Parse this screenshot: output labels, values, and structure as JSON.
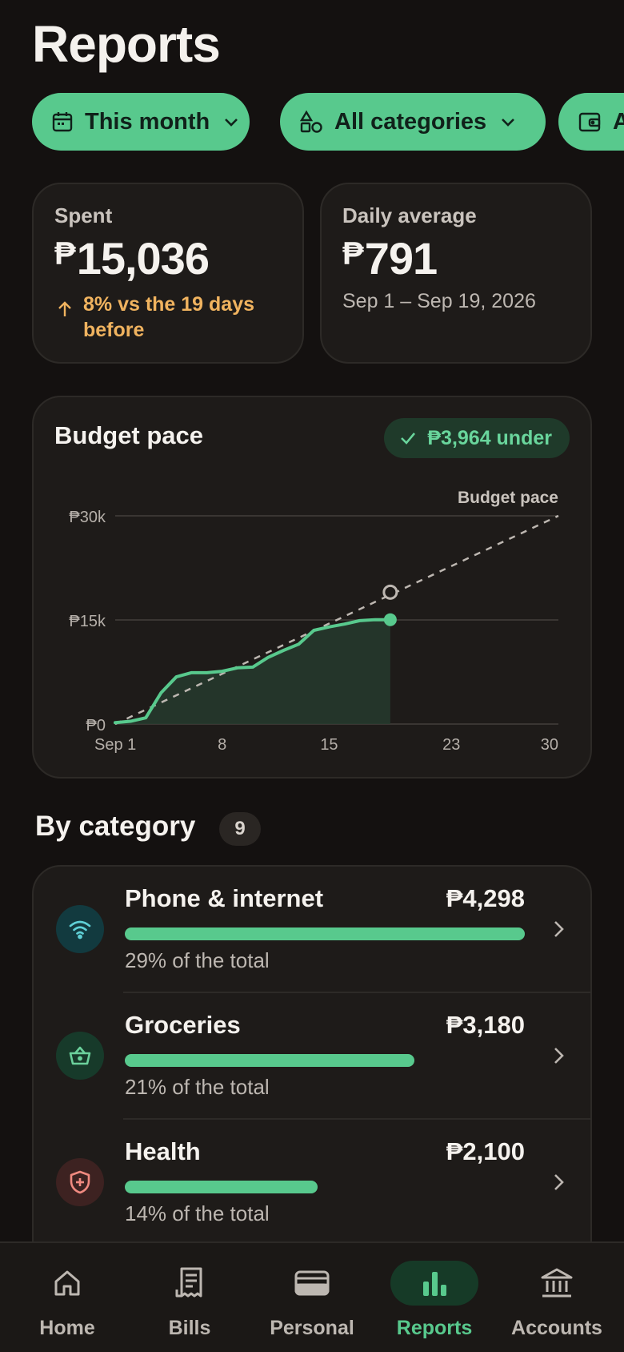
{
  "header": {
    "title": "Reports"
  },
  "filters": [
    {
      "label": "This month",
      "icon": "calendar-icon"
    },
    {
      "label": "All categories",
      "icon": "shapes-icon"
    },
    {
      "label": "A",
      "icon": "wallet-icon"
    }
  ],
  "spent": {
    "label": "Spent",
    "currency": "₱",
    "value": "15,036",
    "trend": "8% vs the 19 days before"
  },
  "daily_average": {
    "label": "Daily average",
    "currency": "₱",
    "value": "791",
    "range": "Sep 1 – Sep 19, 2026"
  },
  "budget_pace": {
    "title": "Budget pace",
    "badge": "₱3,964 under",
    "line_label": "Budget pace"
  },
  "chart_data": {
    "type": "area",
    "title": "Budget pace",
    "xlabel": "",
    "ylabel": "",
    "x_ticks": [
      "Sep 1",
      "8",
      "15",
      "23",
      "30"
    ],
    "x_tick_values": [
      1,
      8,
      15,
      23,
      30
    ],
    "y_ticks": [
      "₱0",
      "₱15k",
      "₱30k"
    ],
    "y_tick_values": [
      0,
      15000,
      30000
    ],
    "xlim": [
      1,
      30
    ],
    "ylim": [
      0,
      30000
    ],
    "grid": true,
    "series": [
      {
        "name": "",
        "style": "solid-area",
        "x": [
          1,
          2,
          3,
          4,
          5,
          6,
          7,
          8,
          9,
          10,
          11,
          12,
          13,
          14,
          15,
          16,
          17,
          18,
          19
        ],
        "y": [
          200,
          400,
          900,
          4500,
          6800,
          7400,
          7400,
          7600,
          8100,
          8200,
          9600,
          10600,
          11500,
          13500,
          14000,
          14400,
          14900,
          15036,
          15036
        ]
      },
      {
        "name": "Budget pace",
        "style": "dashed",
        "x": [
          1,
          30
        ],
        "y": [
          0,
          30000
        ]
      }
    ],
    "markers": [
      {
        "x": 19,
        "y": 15036,
        "style": "filled"
      },
      {
        "x": 19,
        "y": 19000,
        "style": "hollow"
      }
    ]
  },
  "by_category": {
    "title": "By category",
    "count": "9",
    "items": [
      {
        "name": "Phone & internet",
        "amount": "₱4,298",
        "share_text": "29% of the total",
        "share": 0.29,
        "icon": "wifi-icon",
        "icon_bg": "#123a3f",
        "icon_color": "#5fd0d6"
      },
      {
        "name": "Groceries",
        "amount": "₱3,180",
        "share_text": "21% of the total",
        "share": 0.21,
        "icon": "basket-icon",
        "icon_bg": "#173a2a",
        "icon_color": "#6bd19c"
      },
      {
        "name": "Health",
        "amount": "₱2,100",
        "share_text": "14% of the total",
        "share": 0.14,
        "icon": "shield-plus-icon",
        "icon_bg": "#3d2221",
        "icon_color": "#f08a80"
      }
    ]
  },
  "tabbar": {
    "items": [
      {
        "label": "Home",
        "icon": "home-icon"
      },
      {
        "label": "Bills",
        "icon": "receipt-icon"
      },
      {
        "label": "Personal",
        "icon": "wallet-icon"
      },
      {
        "label": "Reports",
        "icon": "bar-chart-icon",
        "active": true
      },
      {
        "label": "Accounts",
        "icon": "bank-icon"
      }
    ]
  },
  "colors": {
    "accent": "#58c98d",
    "background": "#141110",
    "card": "#1e1b19",
    "warning": "#f0b35f"
  }
}
